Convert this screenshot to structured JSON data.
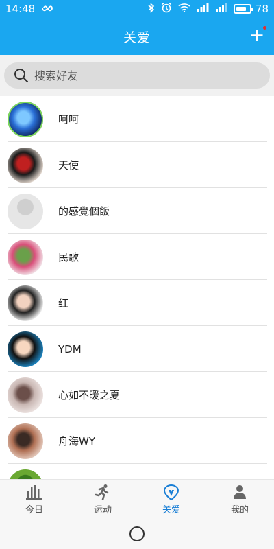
{
  "status": {
    "time": "14:48",
    "battery_text": "78",
    "battery_level": 0.78,
    "icons": [
      "infinity-icon",
      "bluetooth-icon",
      "alarm-icon",
      "wifi-icon",
      "signal-icon",
      "signal-icon",
      "battery-icon"
    ]
  },
  "header": {
    "title": "关爱",
    "add_icon": "plus-icon",
    "has_notification_dot": true,
    "bg_color": "#1aa7f0"
  },
  "search": {
    "placeholder": "搜索好友"
  },
  "friends": [
    {
      "name": "呵呵",
      "avatar_colors": [
        "#0a1a4a",
        "#2a6fd6",
        "#7ec8ff"
      ],
      "avatar_ring": "#7ed957"
    },
    {
      "name": "天使",
      "avatar_colors": [
        "#f2e6dc",
        "#1a1a1a",
        "#c02020"
      ]
    },
    {
      "name": "的感覺個飯",
      "avatar_colors": [
        "#e6e6e6",
        "#cfcfcf"
      ]
    },
    {
      "name": "民歌",
      "avatar_colors": [
        "#f3eef0",
        "#d94f7a",
        "#6aa04a"
      ]
    },
    {
      "name": "红",
      "avatar_colors": [
        "#ffffff",
        "#222222",
        "#f2d2c0"
      ]
    },
    {
      "name": "YDM",
      "avatar_colors": [
        "#1e8fd0",
        "#111111",
        "#f7d7c0"
      ]
    },
    {
      "name": "心如不暖之夏",
      "avatar_colors": [
        "#efe6e4",
        "#c9b7b3",
        "#6b4f4a"
      ]
    },
    {
      "name": "舟海WY",
      "avatar_colors": [
        "#e8d0c4",
        "#b07054",
        "#3a2a24"
      ]
    },
    {
      "name": "",
      "avatar_colors": [
        "#6aa832",
        "#3a7a1e"
      ]
    }
  ],
  "tabs": [
    {
      "label": "今日",
      "icon": "bar-chart-icon",
      "active": false
    },
    {
      "label": "运动",
      "icon": "runner-icon",
      "active": false
    },
    {
      "label": "关爱",
      "icon": "heart-shield-icon",
      "active": true
    },
    {
      "label": "我的",
      "icon": "person-icon",
      "active": false
    }
  ],
  "colors": {
    "accent": "#1aa7f0",
    "active_tab": "#1a7fd6"
  }
}
